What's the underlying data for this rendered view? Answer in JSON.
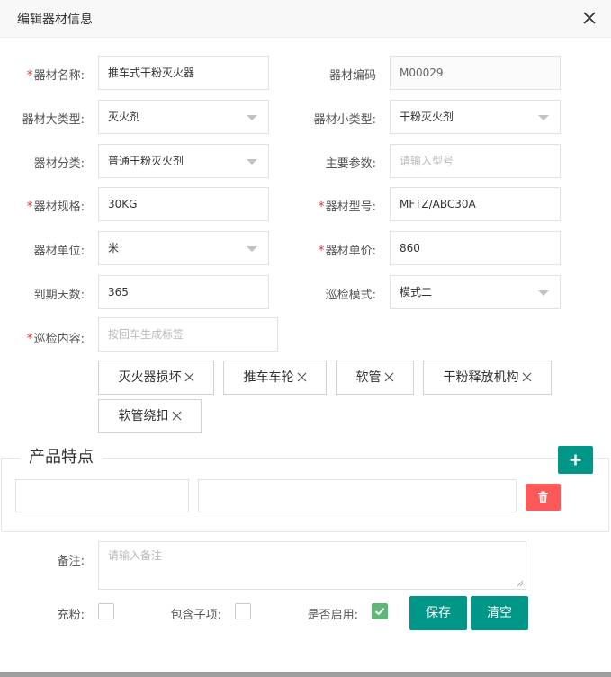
{
  "dialog": {
    "title": "编辑器材信息"
  },
  "form": {
    "name": {
      "label": "器材名称:",
      "value": "推车式干粉灭火器",
      "required": true
    },
    "code": {
      "label": "器材编码",
      "value": "M00029",
      "required": false
    },
    "major_type": {
      "label": "器材大类型:",
      "value": "灭火剂",
      "required": false
    },
    "minor_type": {
      "label": "器材小类型:",
      "value": "干粉灭火剂",
      "required": false
    },
    "category": {
      "label": "器材分类:",
      "value": "普通干粉灭火剂",
      "required": false
    },
    "main_params": {
      "label": "主要参数:",
      "placeholder": "请输入型号",
      "required": false
    },
    "spec": {
      "label": "器材规格:",
      "value": "30KG",
      "required": true
    },
    "model": {
      "label": "器材型号:",
      "value": "MFTZ/ABC30A",
      "required": true
    },
    "unit": {
      "label": "器材单位:",
      "value": "米",
      "required": false
    },
    "price": {
      "label": "器材单价:",
      "value": "860",
      "required": true
    },
    "expiry_days": {
      "label": "到期天数:",
      "value": "365",
      "required": false
    },
    "inspection_mode": {
      "label": "巡检模式:",
      "value": "模式二",
      "required": false
    },
    "inspection_content": {
      "label": "巡检内容:",
      "placeholder": "按回车生成标签",
      "required": true
    }
  },
  "tags": [
    "灭火器损坏",
    "推车车轮",
    "软管",
    "干粉释放机构",
    "软管绕扣"
  ],
  "features": {
    "legend": "产品特点"
  },
  "remark": {
    "label": "备注:",
    "placeholder": "请输入备注"
  },
  "checkboxes": [
    {
      "label": "充粉:",
      "checked": false
    },
    {
      "label": "包含子项:",
      "checked": false
    },
    {
      "label": "是否启用:",
      "checked": true
    }
  ],
  "buttons": {
    "save": "保存",
    "clear": "清空"
  },
  "colors": {
    "primary": "#009688",
    "danger": "#ff5858",
    "required": "#e53935",
    "check": "#5fb878"
  }
}
